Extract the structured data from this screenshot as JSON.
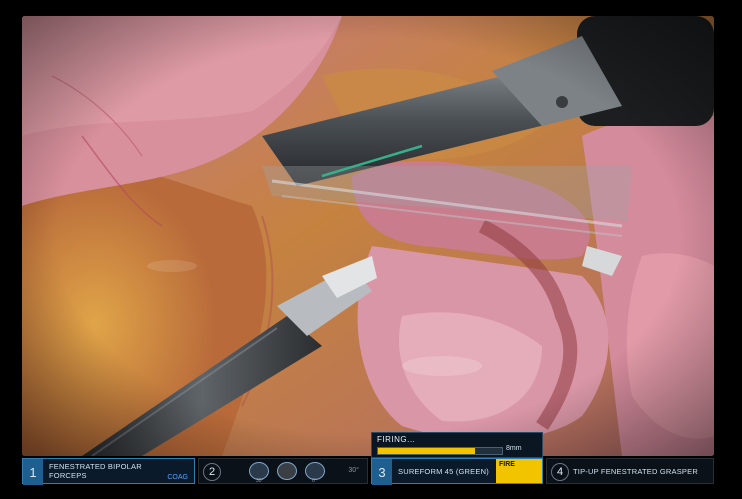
{
  "scene": {
    "description_tag": "laparoscopic-surgery-view",
    "colors": {
      "tissue_pink": "#d38a98",
      "fat_yellow": "#d59a45",
      "instrument_dark": "#3f4448",
      "accent_blue": "#2e7eb8",
      "accent_yellow": "#f2c400"
    }
  },
  "firing_panel": {
    "title": "FIRING...",
    "progress_pct": 78,
    "size_label": "8mm"
  },
  "instruments": [
    {
      "number": "1",
      "label": "FENESTRATED BIPOLAR FORCEPS",
      "badge": "COAG",
      "active": true
    },
    {
      "number": "2",
      "label": "",
      "icons": [
        "camera-icon",
        "endowrist-icon",
        "camera-icon"
      ],
      "icon_captions": [
        "30°",
        "",
        "0°"
      ],
      "angle": "30°",
      "active": false
    },
    {
      "number": "3",
      "label": "SUREFORM 45 (GREEN)",
      "badge": "FIRE",
      "active": true
    },
    {
      "number": "4",
      "label": "TIP-UP FENESTRATED GRASPER",
      "active": false
    }
  ]
}
